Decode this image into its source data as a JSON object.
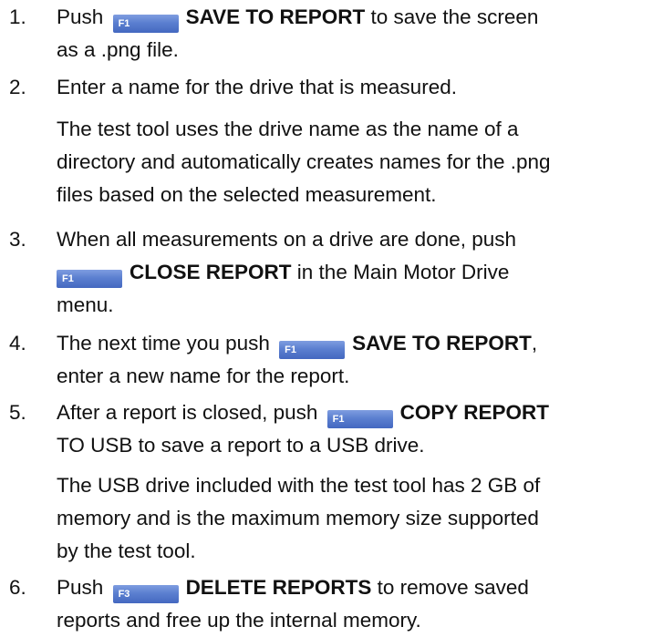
{
  "steps": [
    {
      "num": "1.",
      "lines": [
        {
          "pre": "Push",
          "key": "F1",
          "bold": "SAVE TO REPORT",
          "post": "to save the screen"
        },
        {
          "text": "as a .png file."
        }
      ]
    },
    {
      "num": "2.",
      "lines": [
        {
          "text": "Enter a name for the drive that is measured."
        }
      ],
      "note": [
        "The test tool uses the drive name as the name of a",
        "directory and automatically creates names for the .png",
        "files based on the selected measurement."
      ]
    },
    {
      "num": "3.",
      "lines": [
        {
          "text": "When all measurements on a drive are done, push"
        },
        {
          "key": "F1",
          "bold": "CLOSE REPORT",
          "post": "in the Main Motor Drive"
        },
        {
          "text": "menu."
        }
      ]
    },
    {
      "num": "4.",
      "lines": [
        {
          "pre": "The next time you push",
          "key": "F1",
          "bold": "SAVE TO REPORT",
          "post": ","
        },
        {
          "text": "enter a new name for the report."
        }
      ]
    },
    {
      "num": "5.",
      "lines": [
        {
          "pre": "After a report is closed, push",
          "key": "F1",
          "bold": "COPY REPORT"
        },
        {
          "text": "TO USB to save a report to a USB drive."
        }
      ],
      "note": [
        "The USB drive included with the test tool has 2 GB of",
        "memory and is the maximum memory size supported",
        "by the test tool."
      ]
    },
    {
      "num": "6.",
      "lines": [
        {
          "pre": "Push",
          "key": "F3",
          "bold": "DELETE REPORTS",
          "post": "to remove saved"
        },
        {
          "text": "reports and free up the internal memory."
        }
      ]
    }
  ]
}
